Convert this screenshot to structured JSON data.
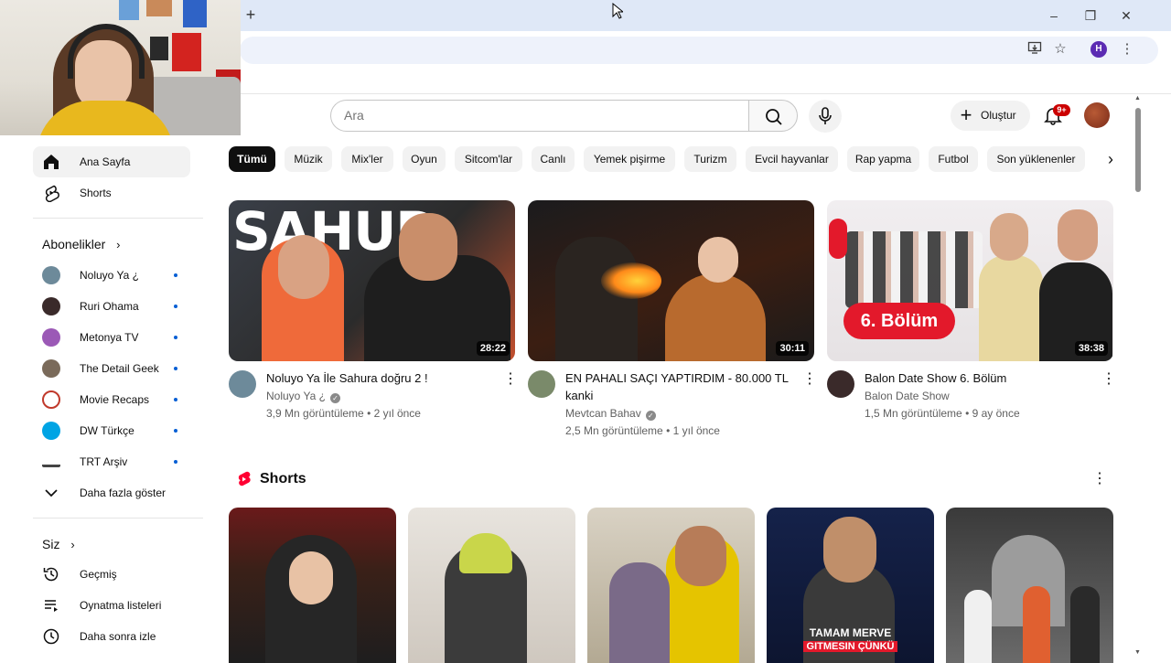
{
  "browser": {
    "new_tab": "+",
    "window_controls": [
      "–",
      "❐",
      "✕"
    ],
    "profile_initial": "H"
  },
  "header": {
    "search_placeholder": "Ara",
    "create_label": "Oluştur",
    "notification_count": "9+"
  },
  "sidebar": {
    "main": [
      {
        "label": "Ana Sayfa",
        "icon": "home-icon",
        "active": true
      },
      {
        "label": "Shorts",
        "icon": "shorts-icon",
        "active": false
      }
    ],
    "subscriptions_title": "Abonelikler",
    "subscriptions": [
      {
        "label": "Noluyo Ya ¿",
        "color": "#6d8a9a"
      },
      {
        "label": "Ruri Ohama",
        "color": "#3a2a2a"
      },
      {
        "label": "Metonya TV",
        "color": "#9b59b6"
      },
      {
        "label": "The Detail Geek",
        "color": "#7a6a5a"
      },
      {
        "label": "Movie Recaps",
        "color": "#c0392b"
      },
      {
        "label": "DW Türkçe",
        "color": "#00a4e4"
      },
      {
        "label": "TRT Arşiv",
        "color": "#444444"
      }
    ],
    "show_more": "Daha fazla göster",
    "you_title": "Siz",
    "you_items": [
      {
        "label": "Geçmiş",
        "icon": "history-icon"
      },
      {
        "label": "Oynatma listeleri",
        "icon": "playlists-icon"
      },
      {
        "label": "Daha sonra izle",
        "icon": "watch-later-icon"
      }
    ]
  },
  "chips": [
    "Tümü",
    "Müzik",
    "Mix'ler",
    "Oyun",
    "Sitcom'lar",
    "Canlı",
    "Yemek pişirme",
    "Turizm",
    "Evcil hayvanlar",
    "Rap yapma",
    "Futbol",
    "Son yüklenenler"
  ],
  "videos": [
    {
      "title": "Noluyo Ya İle Sahura doğru  2 !",
      "title_line2": "",
      "channel": "Noluyo Ya ¿",
      "meta": "3,9 Mn görüntüleme • 2 yıl önce",
      "duration": "28:22",
      "thumb_text": "SAHUR"
    },
    {
      "title": "EN PAHALI SAÇI YAPTIRDIM - 80.000 TL",
      "title_line2": "kanki",
      "channel": "Mevtcan Bahav",
      "meta": "2,5 Mn görüntüleme • 1 yıl önce",
      "duration": "30:11",
      "thumb_text": ""
    },
    {
      "title": "Balon Date Show 6. Bölüm",
      "title_line2": "",
      "channel": "Balon Date Show",
      "meta": "1,5 Mn görüntüleme • 9 ay önce",
      "duration": "38:38",
      "thumb_text": "6. Bölüm"
    }
  ],
  "shorts": {
    "title": "Shorts",
    "items": [
      {
        "caption": ""
      },
      {
        "caption": ""
      },
      {
        "caption": ""
      },
      {
        "caption": "TAMAM MERVE"
      },
      {
        "caption": ""
      }
    ],
    "caption_highlight": "GITMESIN ÇÜNKÜ"
  }
}
